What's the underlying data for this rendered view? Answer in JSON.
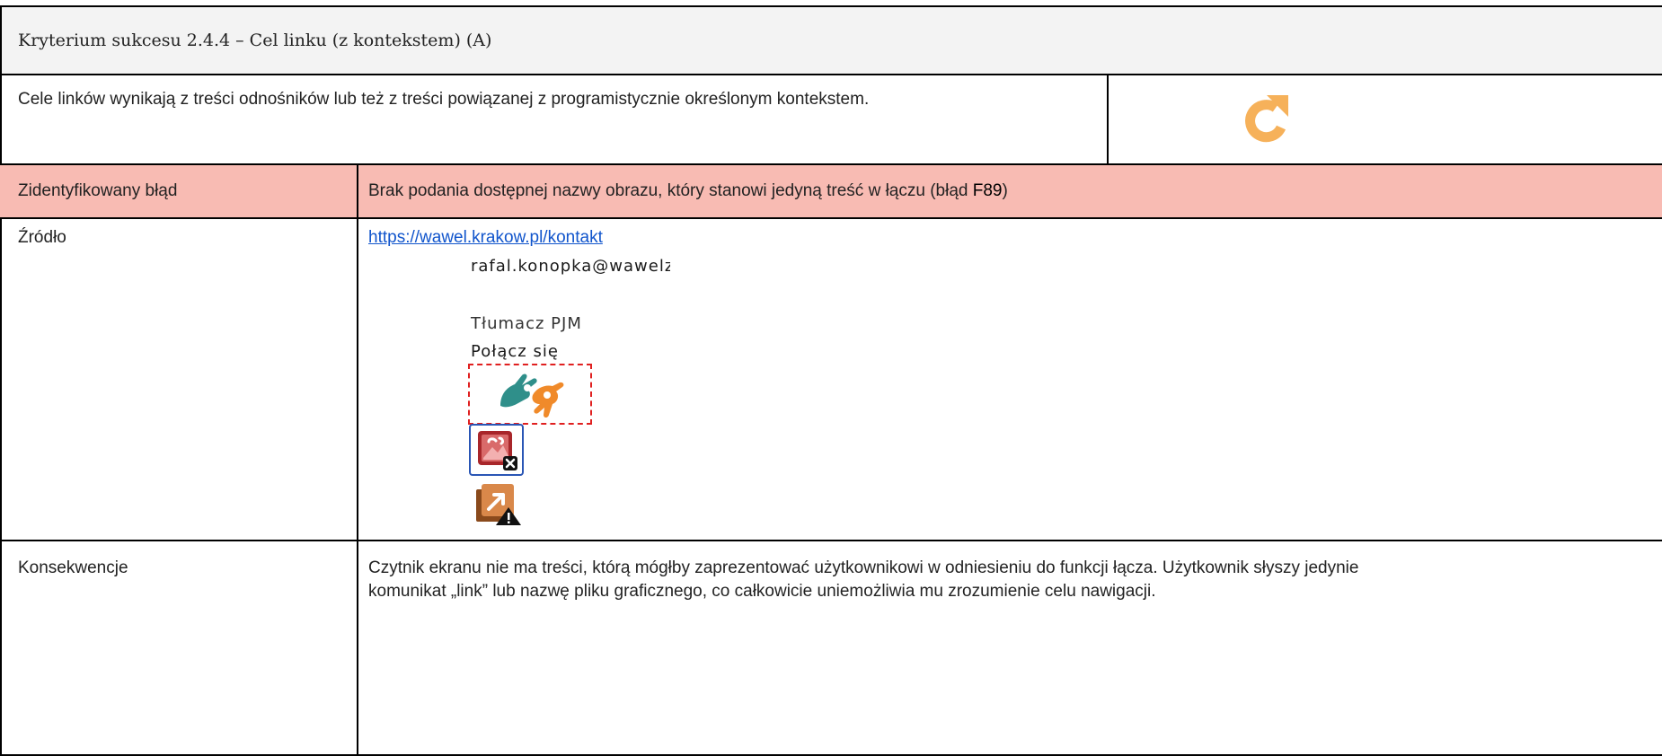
{
  "title": "Kryterium sukcesu 2.4.4 – Cel linku (z kontekstem) (A)",
  "description": "Cele linków wynikają z treści odnośników lub też z treści powiązanej z programistycznie określonym kontekstem.",
  "status_icon": "refresh-icon",
  "colors": {
    "error_row": "#f8bbb3",
    "title_bg": "#f3f3f3",
    "icon_orange": "#f6b15a",
    "link": "#1155cc"
  },
  "error": {
    "label": "Zidentyfikowany błąd",
    "text_before": "Brak podania dostępnej nazwy obrazu, który stanowi jedyną treść w łączu (błąd ",
    "code": "F89",
    "text_after": ")"
  },
  "source": {
    "label": "Źródło",
    "url": "https://wawel.krakow.pl/kontakt",
    "screenshot": {
      "email": "rafal.konopka@wawelz",
      "section": "Tłumacz PJM",
      "action": "Połącz się",
      "icons": [
        "sign-language-hands-icon",
        "broken-image-link-icon",
        "image-link-warning-icon"
      ]
    }
  },
  "consequences": {
    "label": "Konsekwencje",
    "text": "Czytnik ekranu nie ma treści, którą mógłby zaprezentować użytkownikowi w odniesieniu do funkcji łącza. Użytkownik słyszy jedynie komunikat „link” lub nazwę pliku graficznego, co całkowicie uniemożliwia mu zrozumienie celu nawigacji."
  }
}
